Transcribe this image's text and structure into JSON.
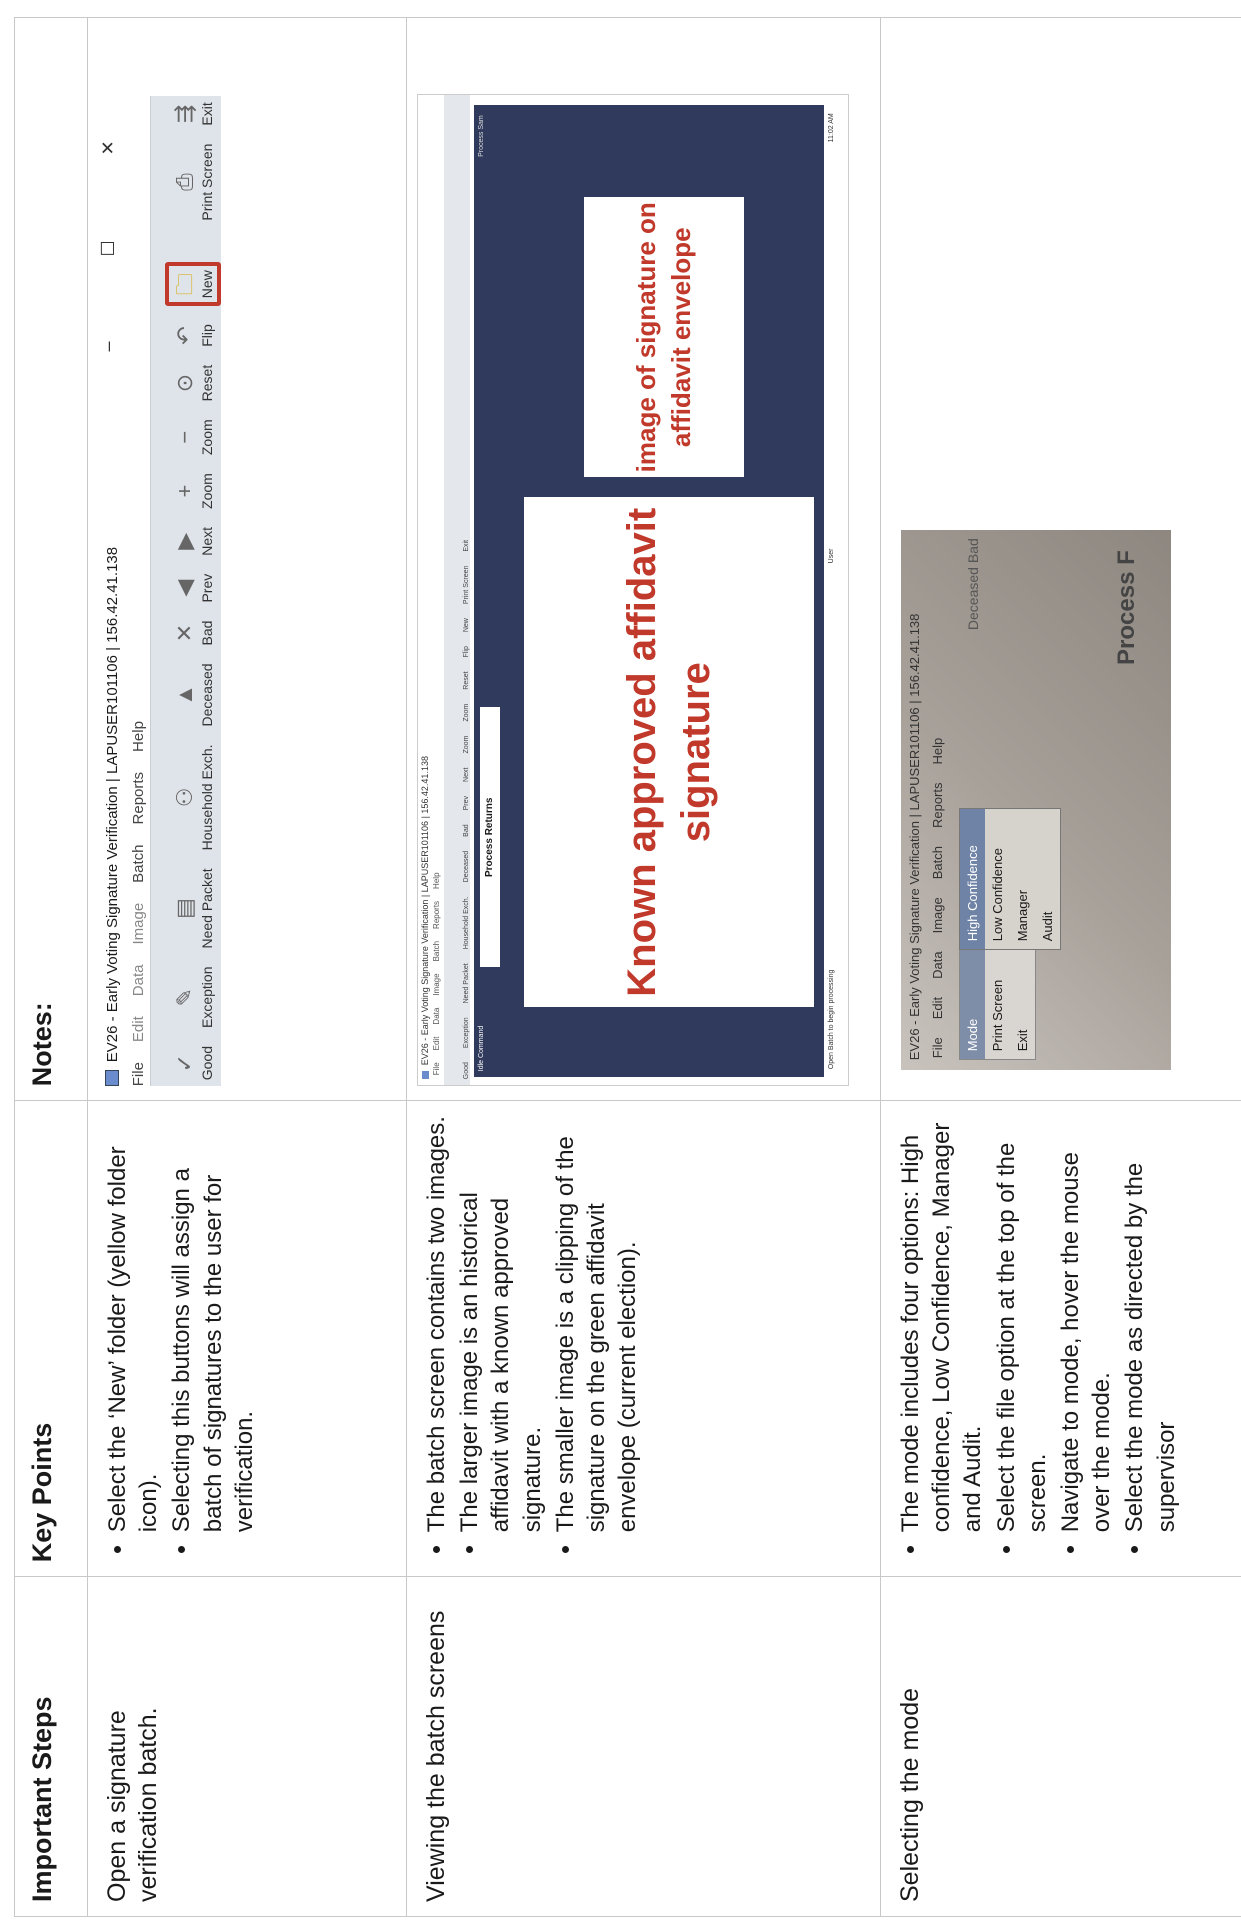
{
  "table": {
    "headers": [
      "Important Steps",
      "Key Points",
      "Notes:"
    ],
    "rows": [
      {
        "step": "Open a signature verification batch.",
        "points": [
          "Select the ‘New’ folder (yellow folder icon).",
          "Selecting this buttons will assign a batch of signatures to the user for verification."
        ]
      },
      {
        "step": "Viewing the batch screens",
        "points": [
          "The batch screen contains two images.",
          "The larger image is an historical affidavit with a known approved signature.",
          "The smaller image is a clipping of the signature on the green affidavit envelope (current election)."
        ]
      },
      {
        "step": "Selecting the mode",
        "points": [
          "The mode includes four options: High confidence, Low Confidence, Manager and Audit.",
          "Select the file option at the top of the screen.",
          "Navigate to mode, hover the mouse over the mode.",
          "Select the mode as directed by the supervisor"
        ]
      }
    ]
  },
  "toolbar_shot": {
    "title": "EV26 - Early Voting Signature Verification | LAPUSER101106 | 156.42.41.138",
    "menu": [
      "File",
      "Edit",
      "Data",
      "Image",
      "Batch",
      "Reports",
      "Help"
    ],
    "tools": [
      "Good",
      "Exception",
      "Need Packet",
      "Household Exch.",
      "Deceased",
      "Bad",
      "Prev",
      "Next",
      "Zoom",
      "Zoom",
      "Reset",
      "Flip",
      "New",
      "Print Screen",
      "Exit"
    ],
    "new_label": "New"
  },
  "batch_shot": {
    "title": "EV26 - Early Voting Signature Verification | LAPUSER101106 | 156.42.41.138",
    "menu": [
      "File",
      "Edit",
      "Data",
      "Image",
      "Batch",
      "Reports",
      "Help"
    ],
    "area_label": "Idle Command",
    "process_label": "Process Returns",
    "right_label": "Process Sam",
    "big_image_text": "Known approved affidavit signature",
    "small_image_text": "image of signature on affidavit envelope",
    "status_left": "Open Batch to begin processing",
    "status_mid": "User",
    "status_right": "11:02 AM"
  },
  "mode_shot": {
    "title": "EV26 - Early Voting Signature Verification | LAPUSER101106 | 156.42.41.138",
    "menu": [
      "File",
      "Edit",
      "Data",
      "Image",
      "Batch",
      "Reports",
      "Help"
    ],
    "file_items": [
      "Mode",
      "Print Screen",
      "Exit"
    ],
    "mode_options": [
      "High Confidence",
      "Low Confidence",
      "Manager",
      "Audit"
    ],
    "right_items": "Deceased   Bad",
    "process_text": "Process F"
  }
}
